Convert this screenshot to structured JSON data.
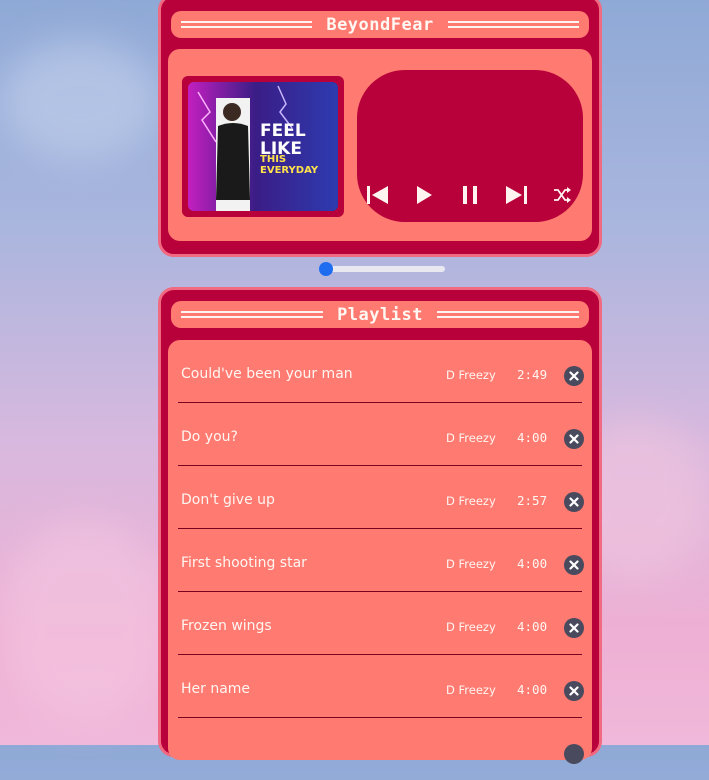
{
  "player": {
    "title": "BeyondFear",
    "album_art": {
      "line1": "FEEL LIKE",
      "line2": "THIS EVERYDAY"
    },
    "controls": [
      {
        "name": "previous",
        "icon": "skip-previous-icon"
      },
      {
        "name": "play",
        "icon": "play-icon"
      },
      {
        "name": "pause",
        "icon": "pause-icon"
      },
      {
        "name": "next",
        "icon": "skip-next-icon"
      },
      {
        "name": "shuffle",
        "icon": "shuffle-icon"
      }
    ],
    "progress": 0.0
  },
  "playlist": {
    "title": "Playlist",
    "tracks": [
      {
        "name": "Could've been your man",
        "artist": "D Freezy",
        "duration": "2:49"
      },
      {
        "name": "Do you?",
        "artist": "D Freezy",
        "duration": "4:00"
      },
      {
        "name": "Don't give up",
        "artist": "D Freezy",
        "duration": "2:57"
      },
      {
        "name": "First shooting star",
        "artist": "D Freezy",
        "duration": "4:00"
      },
      {
        "name": "Frozen wings",
        "artist": "D Freezy",
        "duration": "4:00"
      },
      {
        "name": "Her name",
        "artist": "D Freezy",
        "duration": "4:00"
      }
    ]
  },
  "colors": {
    "panel": "#b8003a",
    "panel_border": "#f06a82",
    "inner": "#ff7a70",
    "slider_thumb": "#1e6cf0",
    "delete_button": "#4a4a5e"
  }
}
